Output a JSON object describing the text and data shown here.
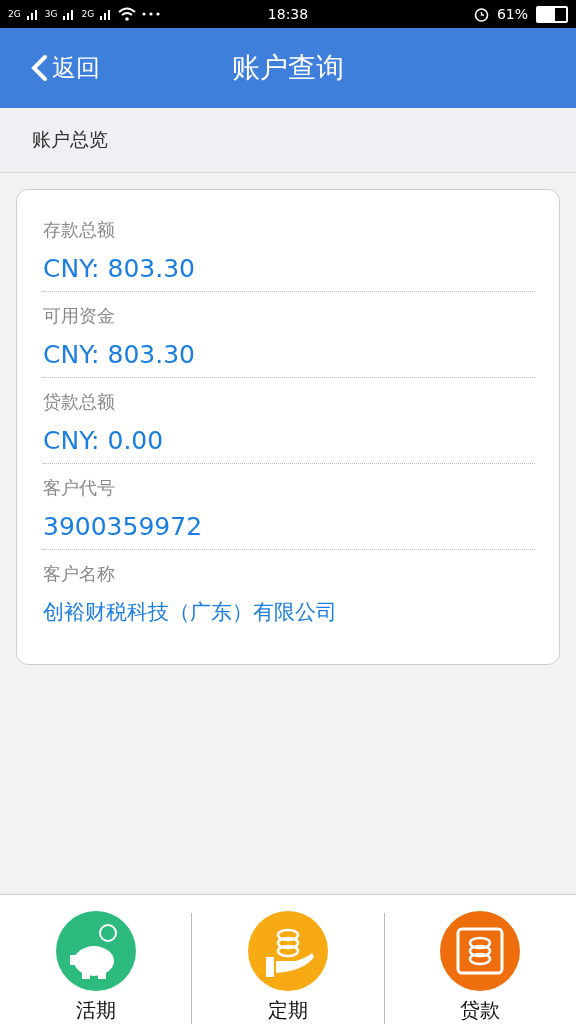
{
  "status_bar": {
    "networks": [
      "2G",
      "3G",
      "2G"
    ],
    "time": "18:38",
    "battery_text": "61%"
  },
  "header": {
    "back": "返回",
    "title": "账户查询"
  },
  "section_title": "账户总览",
  "fields": [
    {
      "label": "存款总额",
      "value": "CNY: 803.30"
    },
    {
      "label": "可用资金",
      "value": "CNY: 803.30"
    },
    {
      "label": "贷款总额",
      "value": "CNY: 0.00"
    },
    {
      "label": "客户代号",
      "value": "3900359972"
    },
    {
      "label": "客户名称",
      "value": "创裕财税科技（广东）有限公司"
    }
  ],
  "bottom_nav": [
    {
      "label": "活期",
      "kind": "piggy",
      "color": "#2dba7e"
    },
    {
      "label": "定期",
      "kind": "hand",
      "color": "#f7aa14"
    },
    {
      "label": "贷款",
      "kind": "frame",
      "color": "#ee6d0c"
    }
  ]
}
